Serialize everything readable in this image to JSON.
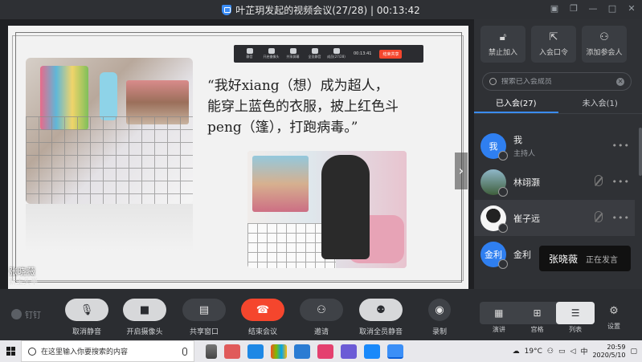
{
  "window": {
    "title": "叶芷玥发起的视频会议(27/28) | 00:13:42"
  },
  "slide": {
    "quote_line1": "“我好xiang（想）成为超人，",
    "quote_line2": "能穿上蓝色的衣服，披上红色斗",
    "quote_line3": "peng（篷），打跑病毒。”",
    "presenter_label": "张晓薇",
    "presenter_sub": "新主头半"
  },
  "mini_toolbar": {
    "items": [
      "静音",
      "开启摄像头",
      "共享屏幕",
      "全员静音",
      "成员(27/28)"
    ],
    "timer": "00:13:41",
    "end_label": "结束共享"
  },
  "panel": {
    "top_buttons": [
      {
        "label": "禁止加入",
        "icon": "lock-icon"
      },
      {
        "label": "入会口令",
        "icon": "share-icon"
      },
      {
        "label": "添加参会人",
        "icon": "add-user-icon"
      }
    ],
    "search_placeholder": "搜索已入会成员",
    "tabs": [
      "已入会(27)",
      "未入会(1)"
    ],
    "members": [
      {
        "name": "我",
        "role": "主持人",
        "avatar_text": "我",
        "avatar_color": "#2f7ff0"
      },
      {
        "name": "林翊灏",
        "role": "",
        "avatar_text": "",
        "avatar_color": "#4b6a4a"
      },
      {
        "name": "崔子远",
        "role": "",
        "avatar_text": "",
        "avatar_color": "#f1f1f1"
      },
      {
        "name": "金利",
        "role": "",
        "avatar_text": "金利",
        "avatar_color": "#2f7ff0"
      }
    ],
    "speaker": {
      "name": "张晓薇",
      "status": "正在发言"
    }
  },
  "toolbar": {
    "brand": "钉钉",
    "buttons": [
      {
        "label": "取消静音",
        "icon": "mic-off-icon"
      },
      {
        "label": "开启摄像头",
        "icon": "camera-icon"
      },
      {
        "label": "共享窗口",
        "icon": "share-window-icon"
      },
      {
        "label": "结束会议",
        "icon": "hangup-icon"
      },
      {
        "label": "邀请",
        "icon": "invite-icon"
      },
      {
        "label": "取消全员静音",
        "icon": "mute-all-icon"
      },
      {
        "label": "录制",
        "icon": "record-icon"
      }
    ],
    "views": [
      "演讲",
      "宫格",
      "列表"
    ],
    "settings": "设置"
  },
  "taskbar": {
    "search_text": "在这里输入你要搜索的内容",
    "temperature": "19°C",
    "ime": "中",
    "time": "20:59",
    "date": "2020/5/10"
  }
}
